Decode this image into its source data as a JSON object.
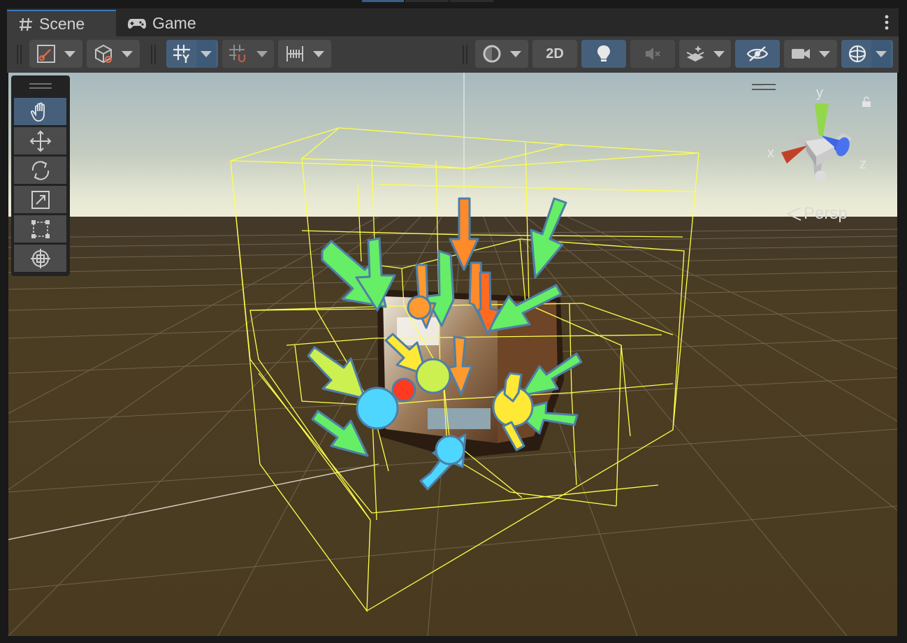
{
  "tabs": [
    {
      "label": "Scene",
      "icon": "hash-icon",
      "active": true
    },
    {
      "label": "Game",
      "icon": "gamepad-icon",
      "active": false
    }
  ],
  "toolbar": {
    "two_d_label": "2D",
    "buttons": [
      "tool-handle-icon",
      "draw-mode-icon",
      "grid-snap-icon",
      "increment-snap-icon",
      "ruler-icon",
      "render-mode-icon",
      "lighting-icon",
      "audio-mute-icon",
      "effects-icon",
      "visibility-icon",
      "camera-icon",
      "gizmos-icon"
    ]
  },
  "tools": [
    "hand-tool-icon",
    "move-tool-icon",
    "rotate-tool-icon",
    "scale-tool-icon",
    "rect-tool-icon",
    "transform-tool-icon"
  ],
  "gizmo": {
    "x_label": "x",
    "y_label": "y",
    "z_label": "z",
    "projection_label": "Persp"
  },
  "colors": {
    "accent": "#46607c",
    "tab_highlight": "#3a79bb",
    "probe_wire": "#ffff4a",
    "ground": "#4a3c23",
    "arrow_green": "#66ee66",
    "arrow_orange": "#ff8a2a",
    "arrow_yellow": "#ffe836",
    "arrow_lime": "#ccf050",
    "arrow_cyan": "#4fd6ff"
  }
}
